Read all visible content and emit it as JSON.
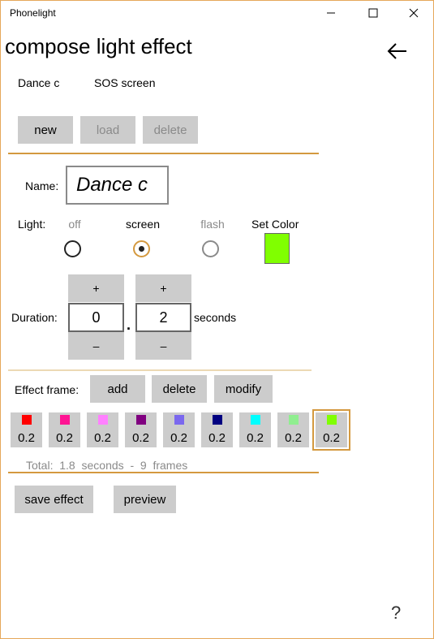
{
  "window": {
    "title": "Phonelight"
  },
  "page": {
    "title": "compose light effect"
  },
  "presets": [
    "Dance c",
    "SOS screen"
  ],
  "effect_buttons": {
    "new": "new",
    "load": "load",
    "delete": "delete"
  },
  "name": {
    "label": "Name:",
    "value": "Dance c"
  },
  "light": {
    "label": "Light:",
    "options": [
      "off",
      "screen",
      "flash"
    ],
    "selected": "screen",
    "set_color_label": "Set Color",
    "color": "#80ff00"
  },
  "duration": {
    "label": "Duration:",
    "plus": "+",
    "minus": "–",
    "dot": ".",
    "whole": "0",
    "fraction": "2",
    "unit": "seconds"
  },
  "effect_frame": {
    "label": "Effect frame:",
    "add": "add",
    "delete": "delete",
    "modify": "modify"
  },
  "frames": [
    {
      "color": "#ff0000",
      "value": "0.2"
    },
    {
      "color": "#ff1493",
      "value": "0.2"
    },
    {
      "color": "#ff80ff",
      "value": "0.2"
    },
    {
      "color": "#800080",
      "value": "0.2"
    },
    {
      "color": "#7b68ee",
      "value": "0.2"
    },
    {
      "color": "#000080",
      "value": "0.2"
    },
    {
      "color": "#00ffff",
      "value": "0.2"
    },
    {
      "color": "#90ee90",
      "value": "0.2"
    },
    {
      "color": "#80ff00",
      "value": "0.2"
    }
  ],
  "selected_frame": 8,
  "summary": {
    "total_label": "Total:",
    "seconds_value": "1.8",
    "seconds_unit": "seconds",
    "sep": "-",
    "frames_value": "9",
    "frames_unit": "frames"
  },
  "footer": {
    "save": "save effect",
    "preview": "preview",
    "help": "?"
  },
  "accent": "#d4993f"
}
